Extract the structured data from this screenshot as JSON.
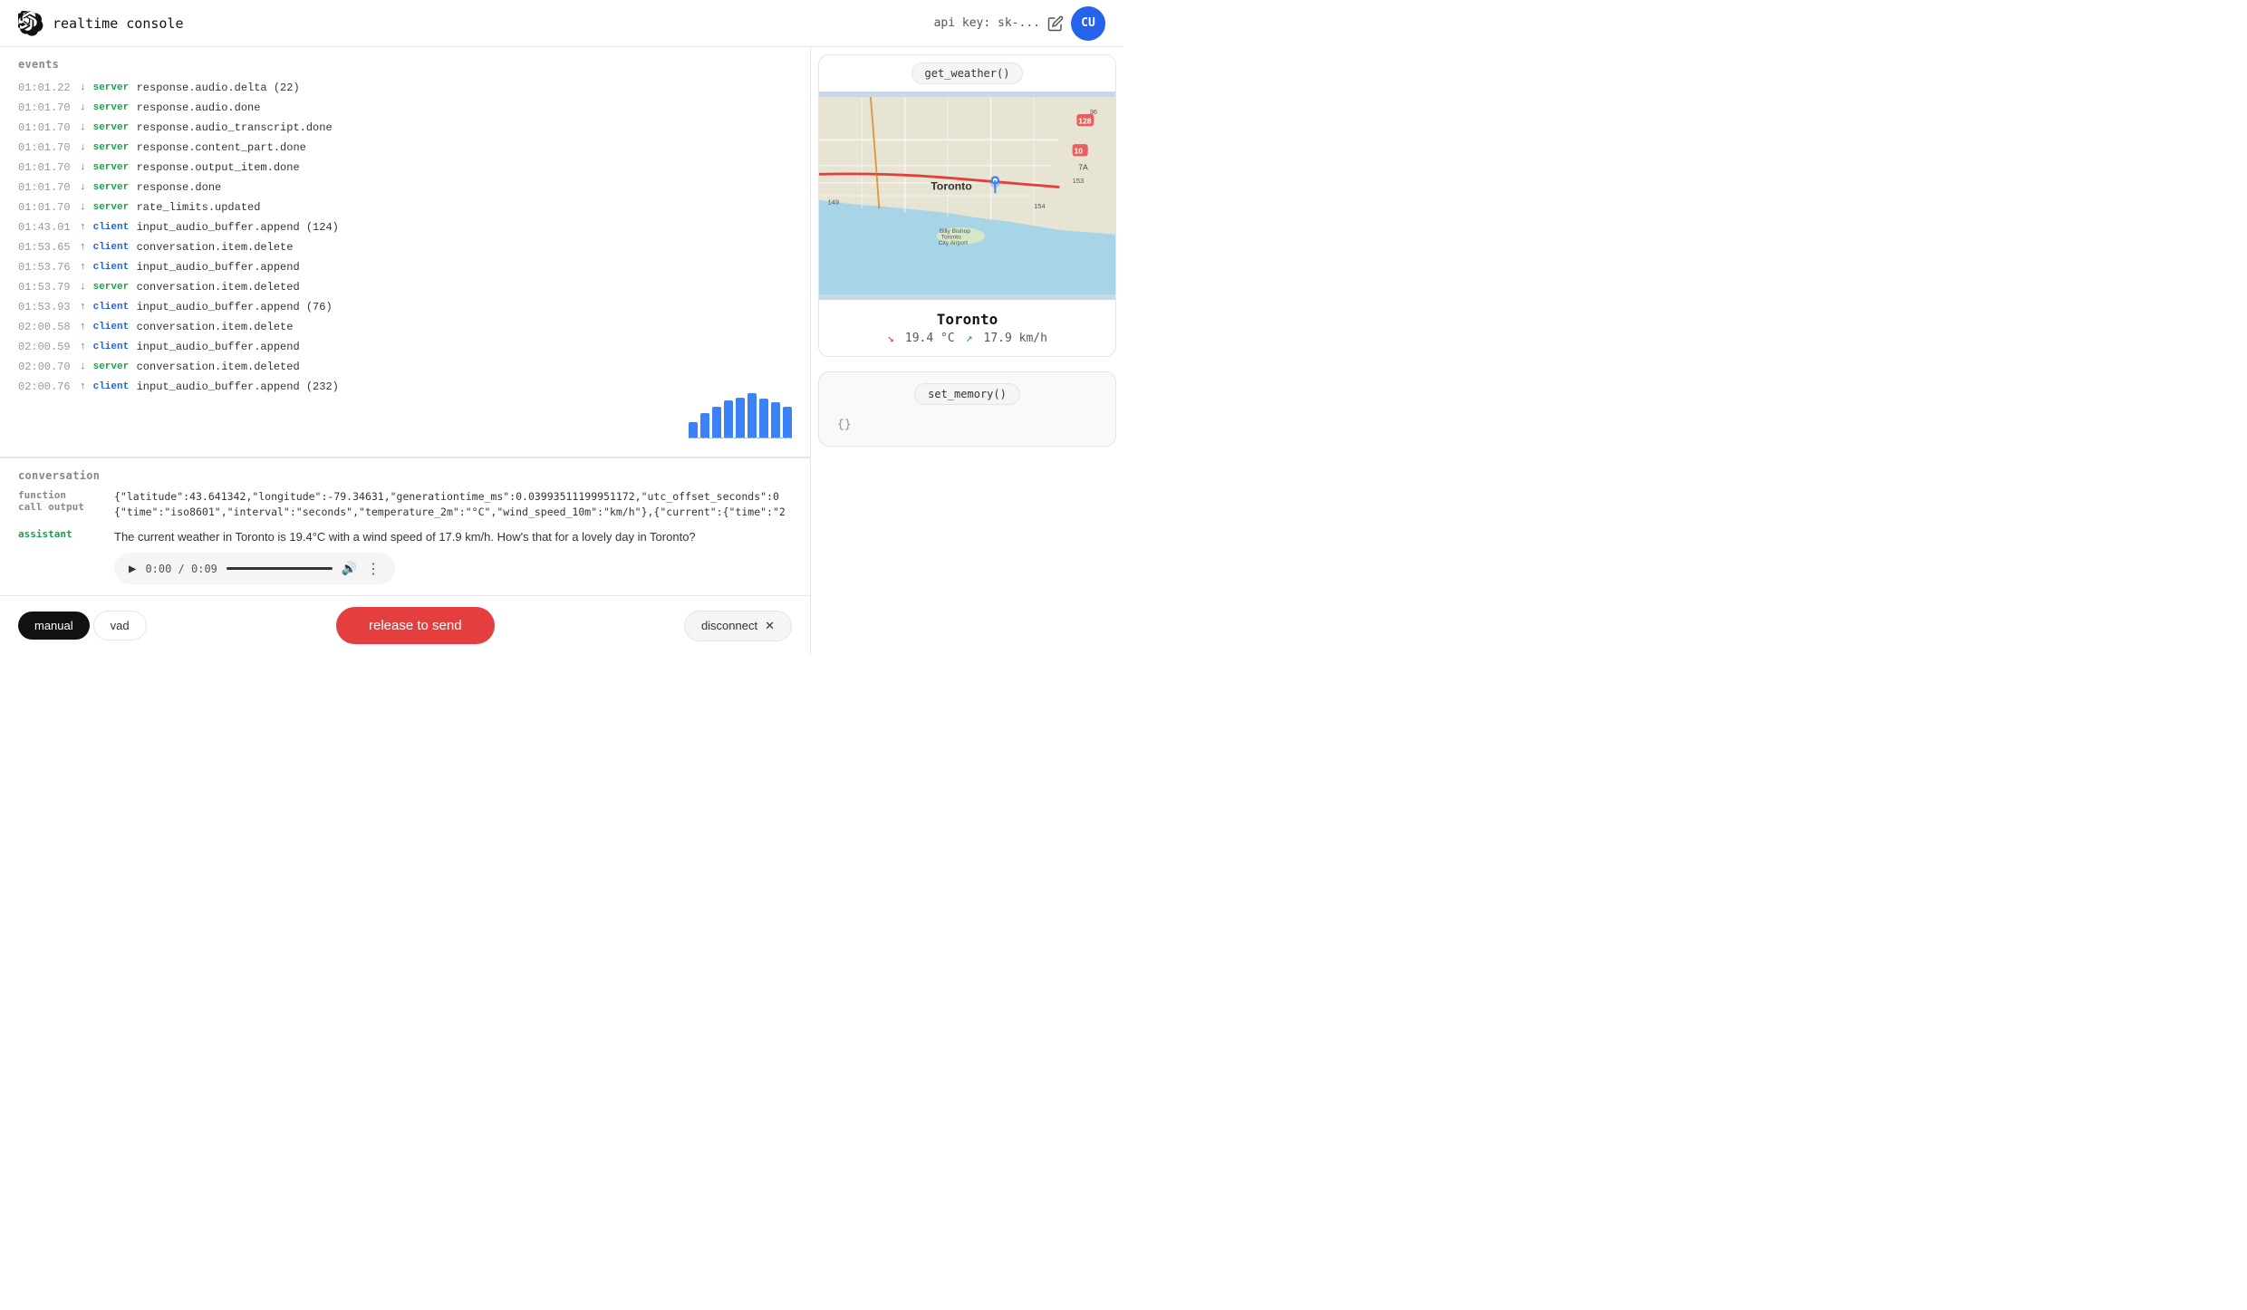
{
  "header": {
    "title": "realtime console",
    "api_key_label": "api key: sk-...",
    "user_initials": "CU"
  },
  "events": {
    "section_label": "events",
    "rows": [
      {
        "time": "01:01.22",
        "direction": "down",
        "source": "server",
        "name": "response.audio.delta (22)"
      },
      {
        "time": "01:01.70",
        "direction": "down",
        "source": "server",
        "name": "response.audio.done"
      },
      {
        "time": "01:01.70",
        "direction": "down",
        "source": "server",
        "name": "response.audio_transcript.done"
      },
      {
        "time": "01:01.70",
        "direction": "down",
        "source": "server",
        "name": "response.content_part.done"
      },
      {
        "time": "01:01.70",
        "direction": "down",
        "source": "server",
        "name": "response.output_item.done"
      },
      {
        "time": "01:01.70",
        "direction": "down",
        "source": "server",
        "name": "response.done"
      },
      {
        "time": "01:01.70",
        "direction": "down",
        "source": "server",
        "name": "rate_limits.updated"
      },
      {
        "time": "01:43.01",
        "direction": "up",
        "source": "client",
        "name": "input_audio_buffer.append (124)"
      },
      {
        "time": "01:53.65",
        "direction": "up",
        "source": "client",
        "name": "conversation.item.delete"
      },
      {
        "time": "01:53.76",
        "direction": "up",
        "source": "client",
        "name": "input_audio_buffer.append"
      },
      {
        "time": "01:53.79",
        "direction": "down",
        "source": "server",
        "name": "conversation.item.deleted"
      },
      {
        "time": "01:53.93",
        "direction": "up",
        "source": "client",
        "name": "input_audio_buffer.append (76)"
      },
      {
        "time": "02:00.58",
        "direction": "up",
        "source": "client",
        "name": "conversation.item.delete"
      },
      {
        "time": "02:00.59",
        "direction": "up",
        "source": "client",
        "name": "input_audio_buffer.append"
      },
      {
        "time": "02:00.70",
        "direction": "down",
        "source": "server",
        "name": "conversation.item.deleted"
      },
      {
        "time": "02:00.76",
        "direction": "up",
        "source": "client",
        "name": "input_audio_buffer.append (232)"
      }
    ]
  },
  "audio_bars": [
    18,
    28,
    35,
    42,
    45,
    50,
    44,
    40,
    35
  ],
  "conversation": {
    "section_label": "conversation",
    "rows": [
      {
        "role": "function\ncall output",
        "content": "{\"latitude\":43.641342,\"longitude\":-79.34631,\"generationtime_ms\":0.03993511199951172,\"utc_offset_seconds\":0",
        "content2": "{\"time\":\"iso8601\",\"interval\":\"seconds\",\"temperature_2m\":\"°C\",\"wind_speed_10m\":\"km/h\"},{\"current\":{\"time\":\"2"
      },
      {
        "role": "assistant",
        "content": "The current weather in Toronto is 19.4°C with a wind speed of 17.9 km/h. How's that for a lovely day in Toronto?"
      }
    ],
    "audio_player": {
      "time": "0:00 / 0:09"
    }
  },
  "toolbar": {
    "manual_label": "manual",
    "vad_label": "vad",
    "release_label": "release to send",
    "disconnect_label": "disconnect"
  },
  "right_panel": {
    "get_weather": {
      "badge": "get_weather()",
      "city": "Toronto",
      "temperature": "19.4 °C",
      "wind": "17.9 km/h"
    },
    "set_memory": {
      "badge": "set_memory()",
      "content": "{}"
    }
  }
}
